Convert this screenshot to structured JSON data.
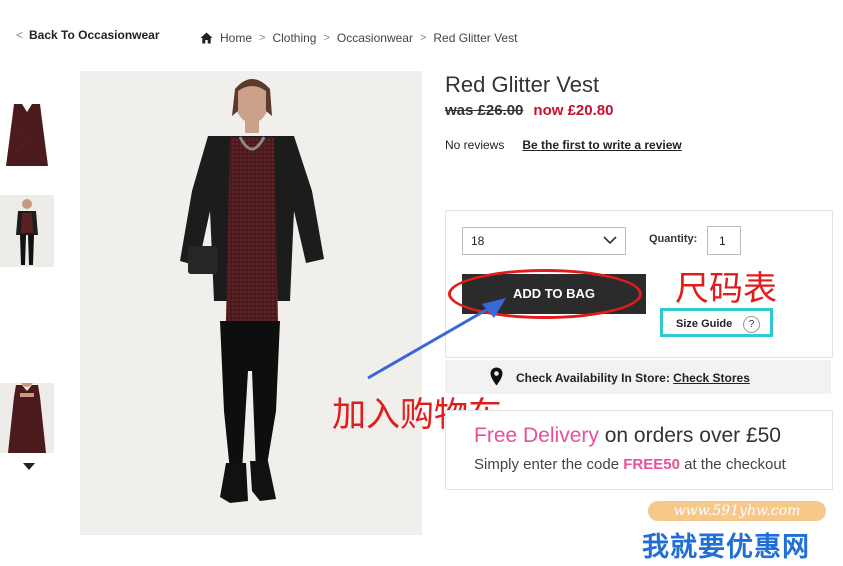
{
  "nav": {
    "back_chevron": "<",
    "back_label": "Back To Occasionwear",
    "breadcrumb": [
      "Home",
      "Clothing",
      "Occasionwear",
      "Red Glitter Vest"
    ],
    "breadcrumb_sep": ">"
  },
  "product": {
    "title": "Red Glitter Vest",
    "was_price": "was £26.00",
    "now_price": "now £20.80",
    "reviews_text": "No reviews",
    "write_review_link": "Be the first to write a review"
  },
  "purchase": {
    "size_value": "18",
    "quantity_label": "Quantity:",
    "quantity_value": "1",
    "add_to_bag_label": "ADD TO BAG",
    "size_guide_label": "Size Guide",
    "size_guide_help": "?"
  },
  "availability": {
    "text": "Check Availability In Store:",
    "link": "Check Stores"
  },
  "delivery": {
    "free_delivery": "Free Delivery",
    "orders_over": " on orders over £50",
    "line2_prefix": "Simply enter the code ",
    "code": "FREE50",
    "line2_suffix": " at the checkout"
  },
  "annotations": {
    "size_chart_cn": "尺码表",
    "add_to_cart_cn": "加入购物车",
    "arrow_color": "#3a67d8",
    "highlight_red": "#e21b1b",
    "highlight_cyan": "#2ec9d1"
  },
  "watermark": {
    "url": "www.591yhw.com",
    "brand_cn": "我就要优惠网"
  },
  "colors": {
    "sale_red": "#c8102e",
    "promo_pink": "#e8509a",
    "button_dark": "#2b2b2b"
  }
}
